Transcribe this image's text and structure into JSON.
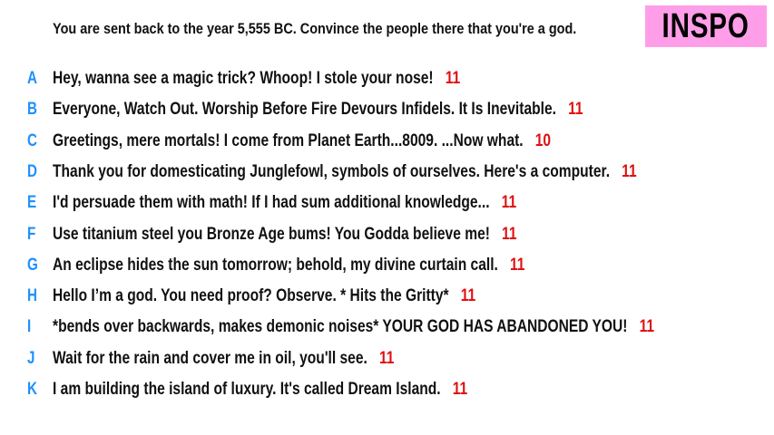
{
  "prompt": "You are sent back to the year 5,555 BC. Convince the people there that you're a god.",
  "badge": "INSPO",
  "colors": {
    "letter": "#1e90ff",
    "score": "#e01010",
    "badge_bg": "#ff9ee8"
  },
  "answers": [
    {
      "letter": "A",
      "text": "Hey, wanna see a magic trick? Whoop! I stole your nose!",
      "score": "11"
    },
    {
      "letter": "B",
      "text": "Everyone, Watch Out. Worship Before Fire Devours Infidels. It Is Inevitable.",
      "score": "11"
    },
    {
      "letter": "C",
      "text": "Greetings, mere mortals! I come from Planet Earth...8009. ...Now what.",
      "score": "10"
    },
    {
      "letter": "D",
      "text": "Thank you for domesticating Junglefowl, symbols of ourselves. Here's a computer.",
      "score": "11"
    },
    {
      "letter": "E",
      "text": "I'd persuade them with math! If I had sum additional knowledge...",
      "score": "11"
    },
    {
      "letter": "F",
      "text": "Use titanium steel you Bronze Age bums! You Godda believe me!",
      "score": "11"
    },
    {
      "letter": "G",
      "text": "An eclipse hides the sun tomorrow; behold, my divine curtain call.",
      "score": "11"
    },
    {
      "letter": "H",
      "text": "Hello I’m a god. You need proof? Observe. * Hits the Gritty*",
      "score": "11"
    },
    {
      "letter": "I",
      "text": "*bends over backwards, makes demonic noises* YOUR GOD HAS ABANDONED YOU!",
      "score": "11"
    },
    {
      "letter": "J",
      "text": "Wait for the rain and cover me in oil, you'll see.",
      "score": "11"
    },
    {
      "letter": "K",
      "text": "I am building the island of luxury. It's called Dream Island.",
      "score": "11"
    }
  ]
}
